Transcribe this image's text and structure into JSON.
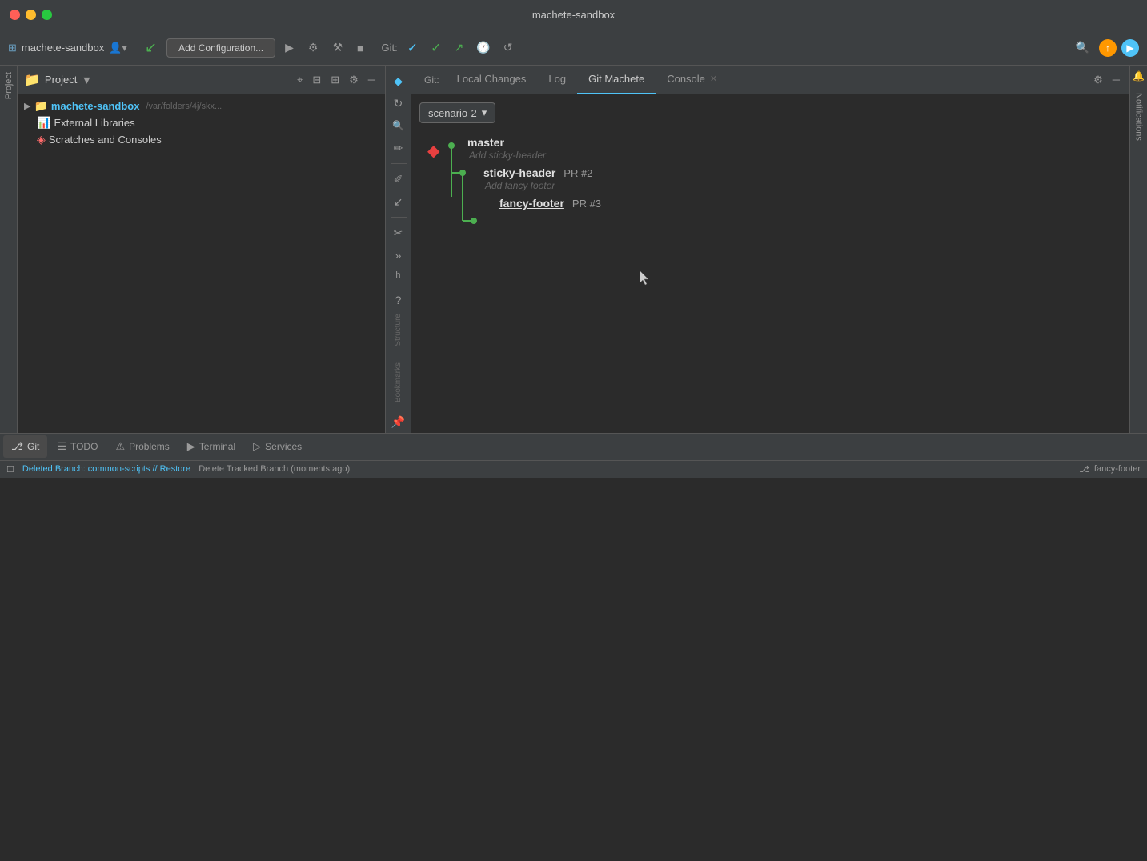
{
  "window": {
    "title": "machete-sandbox"
  },
  "titlebar": {
    "title": "machete-sandbox",
    "controls": {
      "close": "●",
      "min": "●",
      "max": "●"
    }
  },
  "toolbar": {
    "project_label": "machete-sandbox",
    "add_config_label": "Add Configuration...",
    "git_label": "Git:",
    "search_icon": "🔍",
    "run_icon": "▶",
    "debug_icon": "🐛",
    "build_icon": "⚙",
    "stop_icon": "■",
    "back_icon": "↩",
    "git_check1": "✓",
    "git_check2": "✓",
    "git_arrow": "↗",
    "history_icon": "🕐",
    "rollback_icon": "↺"
  },
  "project_panel": {
    "title": "Project",
    "root_name": "machete-sandbox",
    "root_path": "/var/folders/4j/skx...",
    "external_libs": "External Libraries",
    "scratches": "Scratches and Consoles"
  },
  "git_tabs": {
    "git_label": "Git:",
    "tabs": [
      {
        "id": "local-changes",
        "label": "Local Changes",
        "active": false
      },
      {
        "id": "log",
        "label": "Log",
        "active": false
      },
      {
        "id": "git-machete",
        "label": "Git Machete",
        "active": true
      },
      {
        "id": "console",
        "label": "Console",
        "active": false,
        "closeable": true
      }
    ]
  },
  "branch_panel": {
    "dropdown_value": "scenario-2",
    "branches": [
      {
        "id": "master",
        "name": "master",
        "description": "Add sticky-header",
        "pr": "",
        "level": 0,
        "is_current": false
      },
      {
        "id": "sticky-header",
        "name": "sticky-header",
        "description": "Add fancy footer",
        "pr": "PR #2",
        "level": 1,
        "is_current": false
      },
      {
        "id": "fancy-footer",
        "name": "fancy-footer",
        "description": "",
        "pr": "PR #3",
        "level": 2,
        "is_current": true
      }
    ]
  },
  "tool_icons": {
    "git_machete": "◆",
    "sync": "↻",
    "find": "🔍",
    "edit": "✏",
    "edit2": "✏",
    "arrow_down": "↙",
    "scissors": "✂",
    "chevron": "»",
    "hook": "ʰ",
    "question": "?"
  },
  "bottom_tabs": {
    "tabs": [
      {
        "id": "git",
        "label": "Git",
        "icon": "⎇",
        "active": true
      },
      {
        "id": "todo",
        "label": "TODO",
        "icon": "☰",
        "active": false
      },
      {
        "id": "problems",
        "label": "Problems",
        "icon": "⚠",
        "active": false
      },
      {
        "id": "terminal",
        "label": "Terminal",
        "icon": "▶",
        "active": false
      },
      {
        "id": "services",
        "label": "Services",
        "icon": "▷",
        "active": false
      }
    ]
  },
  "status_bar": {
    "message": "Deleted Branch: common-scripts // Restore",
    "action": "Delete Tracked Branch (moments ago)",
    "branch": "fancy-footer"
  },
  "sidebar_labels": {
    "project": "Project",
    "structure": "Structure",
    "bookmarks": "Bookmarks",
    "notifications": "Notifications"
  }
}
